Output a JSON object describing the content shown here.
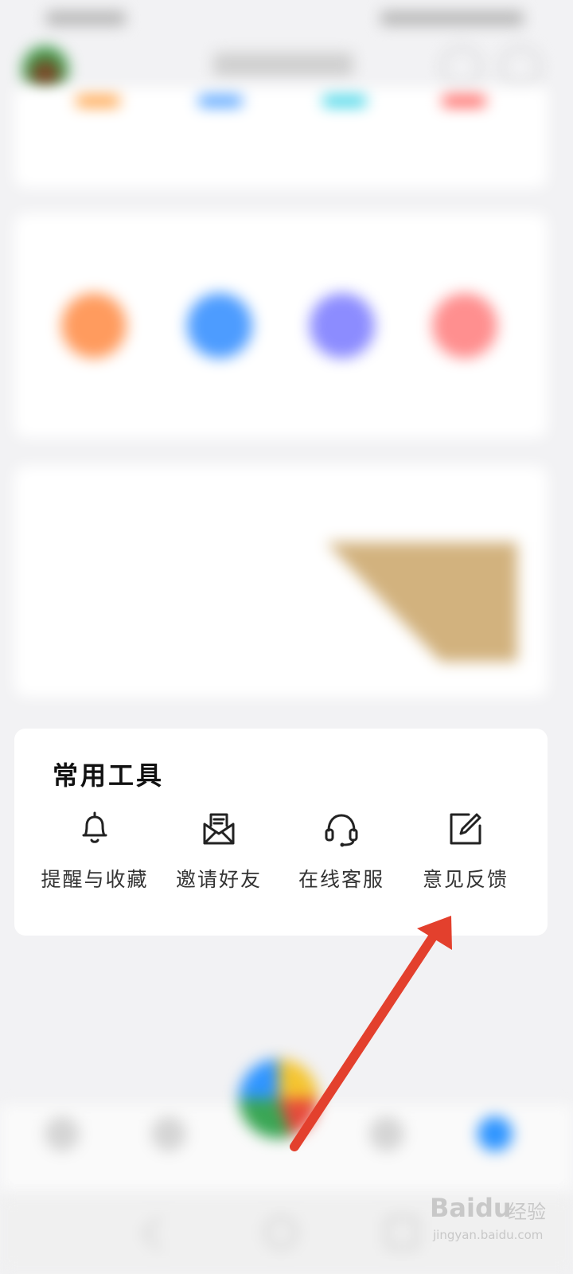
{
  "colors": {
    "arrow": "#e3402d",
    "accent": "#2f95ff",
    "stat_bars": [
      "#ff9d3c",
      "#4a9dff",
      "#39d3e6",
      "#ff5b57"
    ],
    "shop_circles": [
      "#ff9b5e",
      "#4d9cff",
      "#8c8cff",
      "#ff8f8f"
    ]
  },
  "tools": {
    "title": "常用工具",
    "items": [
      {
        "label": "提醒与收藏",
        "icon": "bell-icon"
      },
      {
        "label": "邀请好友",
        "icon": "envelope-icon"
      },
      {
        "label": "在线客服",
        "icon": "headset-icon"
      },
      {
        "label": "意见反馈",
        "icon": "edit-icon"
      }
    ]
  },
  "watermark": {
    "brand": "Baidu",
    "brand_cn": "经验",
    "url": "jingyan.baidu.com"
  }
}
